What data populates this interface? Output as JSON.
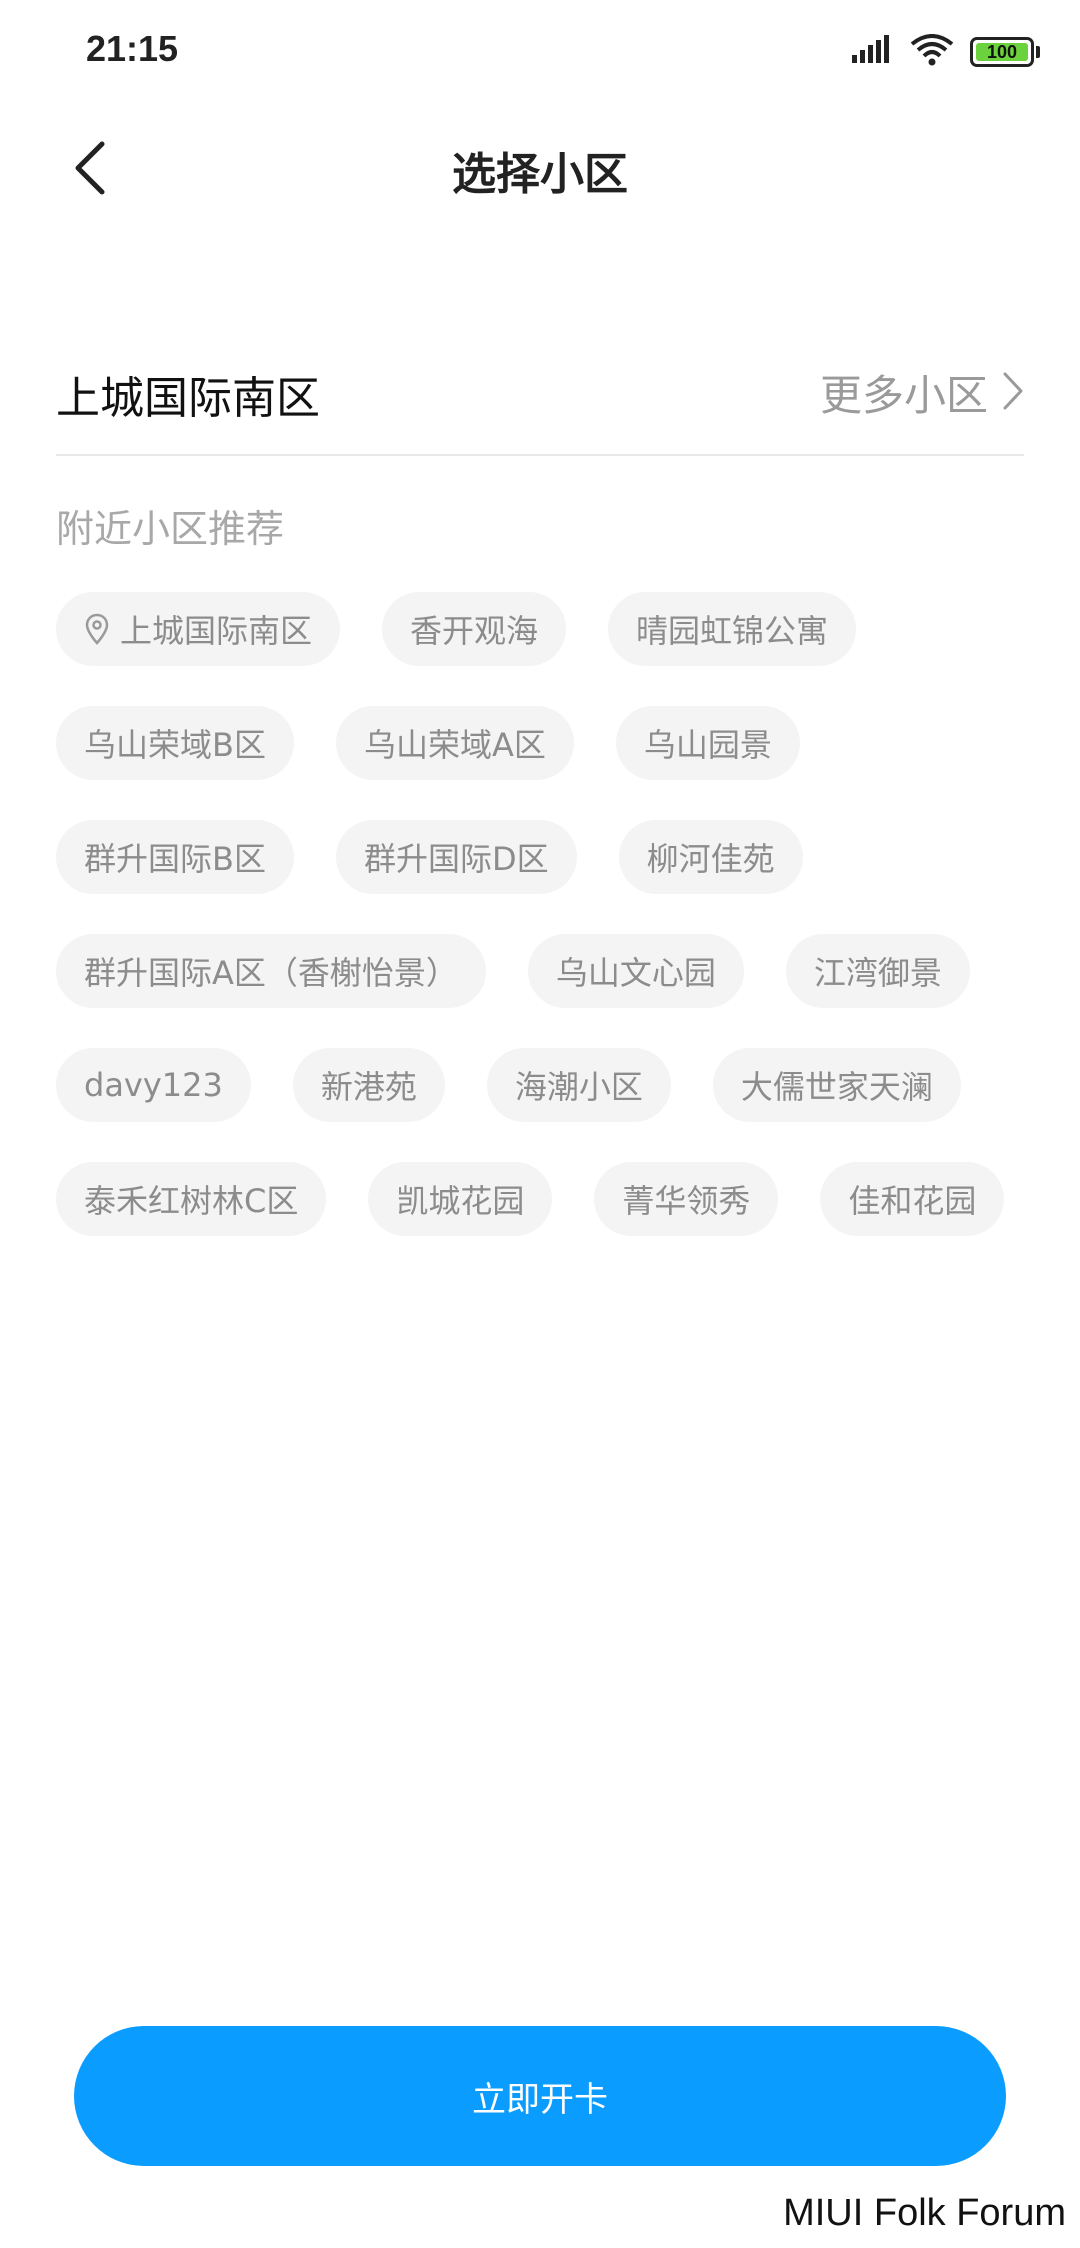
{
  "status_bar": {
    "time": "21:15",
    "battery": "100",
    "icons": [
      "signal-icon",
      "wifi-icon",
      "battery-icon"
    ]
  },
  "header": {
    "title": "选择小区",
    "back_icon": "chevron-left-icon"
  },
  "current": {
    "name": "上城国际南区",
    "more_label": "更多小区"
  },
  "nearby": {
    "title": "附近小区推荐",
    "rows": [
      [
        "上城国际南区",
        "香开观海",
        "晴园虹锦公寓"
      ],
      [
        "乌山荣域B区",
        "乌山荣域A区",
        "乌山园景"
      ],
      [
        "群升国际B区",
        "群升国际D区",
        "柳河佳苑"
      ],
      [
        "群升国际A区（香榭怡景）",
        "乌山文心园",
        "江湾御景"
      ],
      [
        "davy123",
        "新港苑",
        "海潮小区",
        "大儒世家天澜"
      ],
      [
        "泰禾红树林C区",
        "凯城花园",
        "菁华领秀",
        "佳和花园"
      ]
    ]
  },
  "action": {
    "open_card_label": "立即开卡"
  },
  "watermark": "MIUI Folk Forum",
  "colors": {
    "accent": "#0a9cff",
    "chip_bg": "#f4f4f4",
    "chip_text": "#8c8c8c"
  }
}
